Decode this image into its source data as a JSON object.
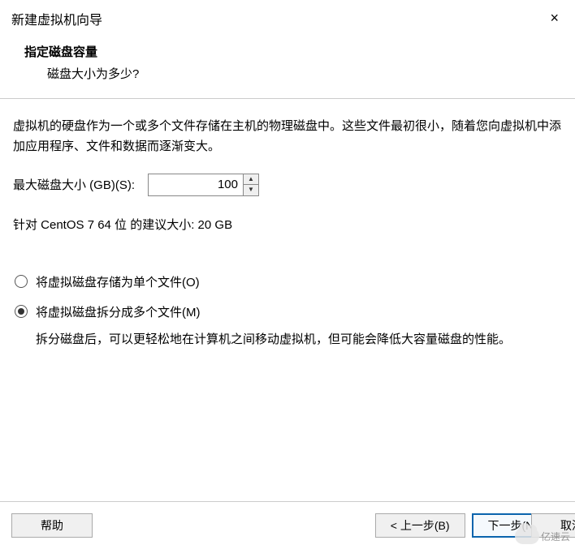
{
  "window": {
    "title": "新建虚拟机向导",
    "close_icon": "×"
  },
  "header": {
    "title": "指定磁盘容量",
    "subtitle": "磁盘大小为多少?"
  },
  "body": {
    "description": "虚拟机的硬盘作为一个或多个文件存储在主机的物理磁盘中。这些文件最初很小，随着您向虚拟机中添加应用程序、文件和数据而逐渐变大。",
    "size_label": "最大磁盘大小 (GB)(S):",
    "size_value": "100",
    "recommend": "针对 CentOS 7 64 位 的建议大小: 20 GB",
    "radios": [
      {
        "label": "将虚拟磁盘存储为单个文件(O)",
        "checked": false
      },
      {
        "label": "将虚拟磁盘拆分成多个文件(M)",
        "checked": true
      }
    ],
    "split_desc": "拆分磁盘后，可以更轻松地在计算机之间移动虚拟机，但可能会降低大容量磁盘的性能。"
  },
  "footer": {
    "help": "帮助",
    "back": "< 上一步(B)",
    "next": "下一步(N) >",
    "cancel": "取消"
  },
  "watermark": "亿速云"
}
